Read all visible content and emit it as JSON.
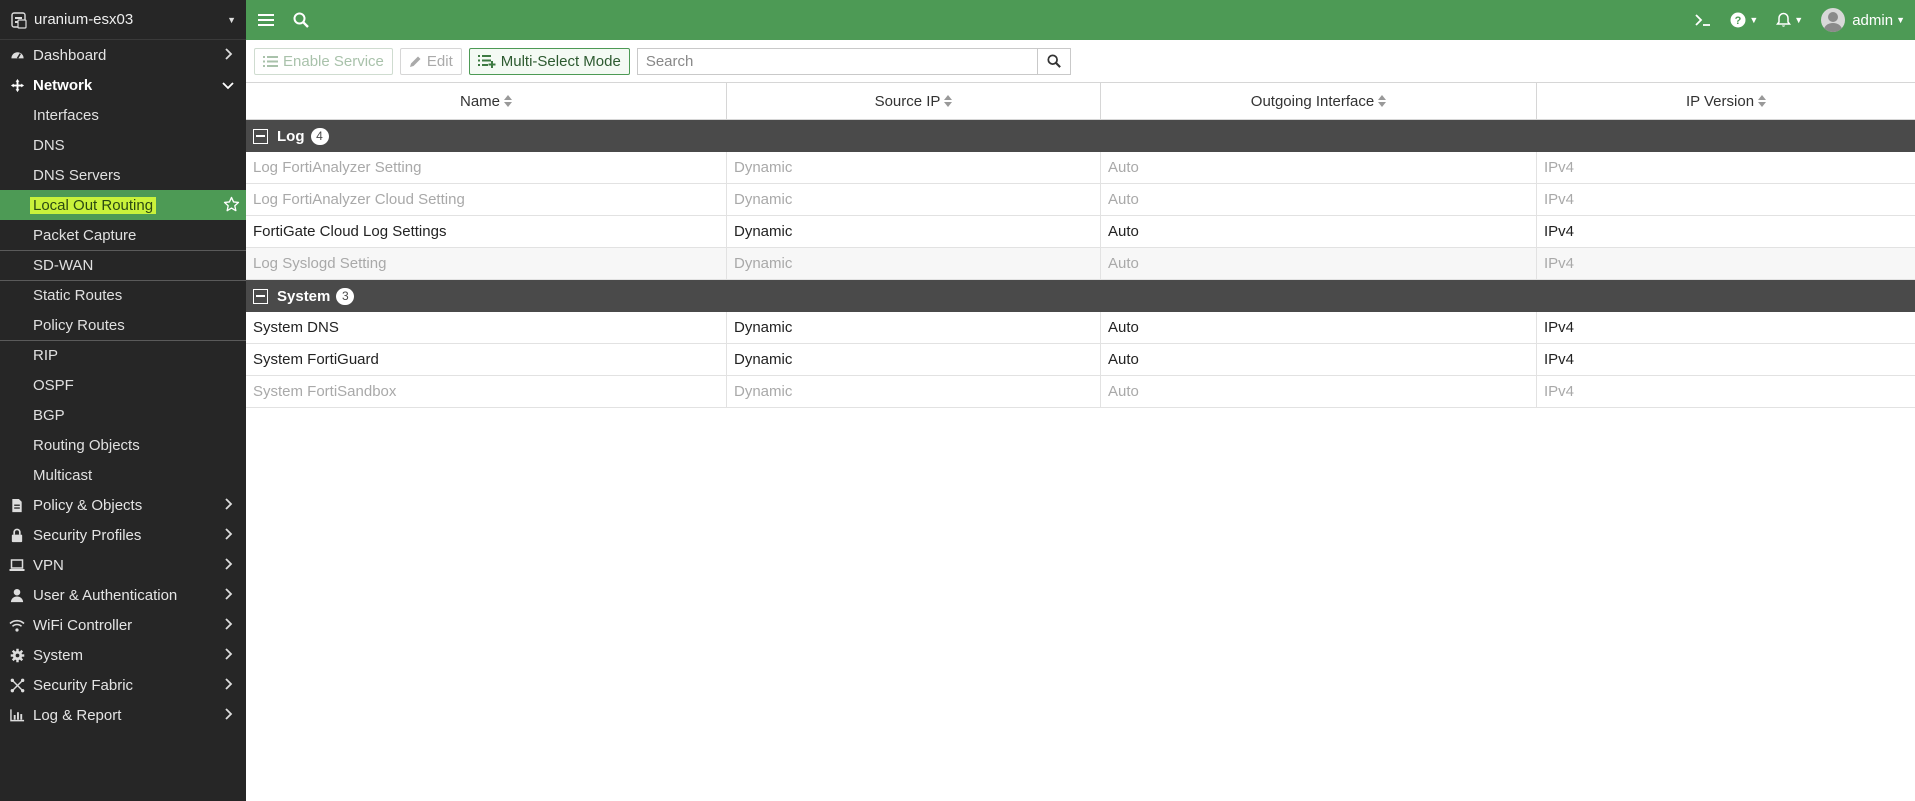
{
  "device": {
    "name": "uranium-esx03"
  },
  "sidebar": {
    "items": [
      {
        "label": "Dashboard",
        "icon": "dashboard-icon"
      },
      {
        "label": "Network",
        "icon": "network-icon",
        "open": true
      },
      {
        "label": "Policy & Objects",
        "icon": "policy-icon"
      },
      {
        "label": "Security Profiles",
        "icon": "lock-icon"
      },
      {
        "label": "VPN",
        "icon": "laptop-icon"
      },
      {
        "label": "User & Authentication",
        "icon": "user-icon"
      },
      {
        "label": "WiFi Controller",
        "icon": "wifi-icon"
      },
      {
        "label": "System",
        "icon": "gear-icon"
      },
      {
        "label": "Security Fabric",
        "icon": "fabric-icon"
      },
      {
        "label": "Log & Report",
        "icon": "chart-icon"
      }
    ],
    "network_sub": [
      "Interfaces",
      "DNS",
      "DNS Servers",
      "Local Out Routing",
      "Packet Capture",
      "SD-WAN",
      "Static Routes",
      "Policy Routes",
      "RIP",
      "OSPF",
      "BGP",
      "Routing Objects",
      "Multicast"
    ],
    "active_item": "Local Out Routing"
  },
  "topbar": {
    "user": "admin"
  },
  "toolbar": {
    "enable_service": "Enable Service",
    "edit": "Edit",
    "multi_select": "Multi-Select Mode",
    "search_placeholder": "Search"
  },
  "table": {
    "columns": [
      "Name",
      "Source IP",
      "Outgoing Interface",
      "IP Version"
    ],
    "groups": [
      {
        "label": "Log",
        "count": "4",
        "rows": [
          {
            "cells": [
              "Log FortiAnalyzer Setting",
              "Dynamic",
              "Auto",
              "IPv4"
            ],
            "dim": true
          },
          {
            "cells": [
              "Log FortiAnalyzer Cloud Setting",
              "Dynamic",
              "Auto",
              "IPv4"
            ],
            "dim": true
          },
          {
            "cells": [
              "FortiGate Cloud Log Settings",
              "Dynamic",
              "Auto",
              "IPv4"
            ],
            "dim": false
          },
          {
            "cells": [
              "Log Syslogd Setting",
              "Dynamic",
              "Auto",
              "IPv4"
            ],
            "dim": true
          }
        ]
      },
      {
        "label": "System",
        "count": "3",
        "rows": [
          {
            "cells": [
              "System DNS",
              "Dynamic",
              "Auto",
              "IPv4"
            ],
            "dim": false
          },
          {
            "cells": [
              "System FortiGuard",
              "Dynamic",
              "Auto",
              "IPv4"
            ],
            "dim": false
          },
          {
            "cells": [
              "System FortiSandbox",
              "Dynamic",
              "Auto",
              "IPv4"
            ],
            "dim": true
          }
        ]
      }
    ]
  },
  "colors": {
    "accent": "#4d9a55",
    "sidebar_bg": "#262626",
    "group_header_bg": "#4a4a4a",
    "highlight": "#c9f23b"
  }
}
